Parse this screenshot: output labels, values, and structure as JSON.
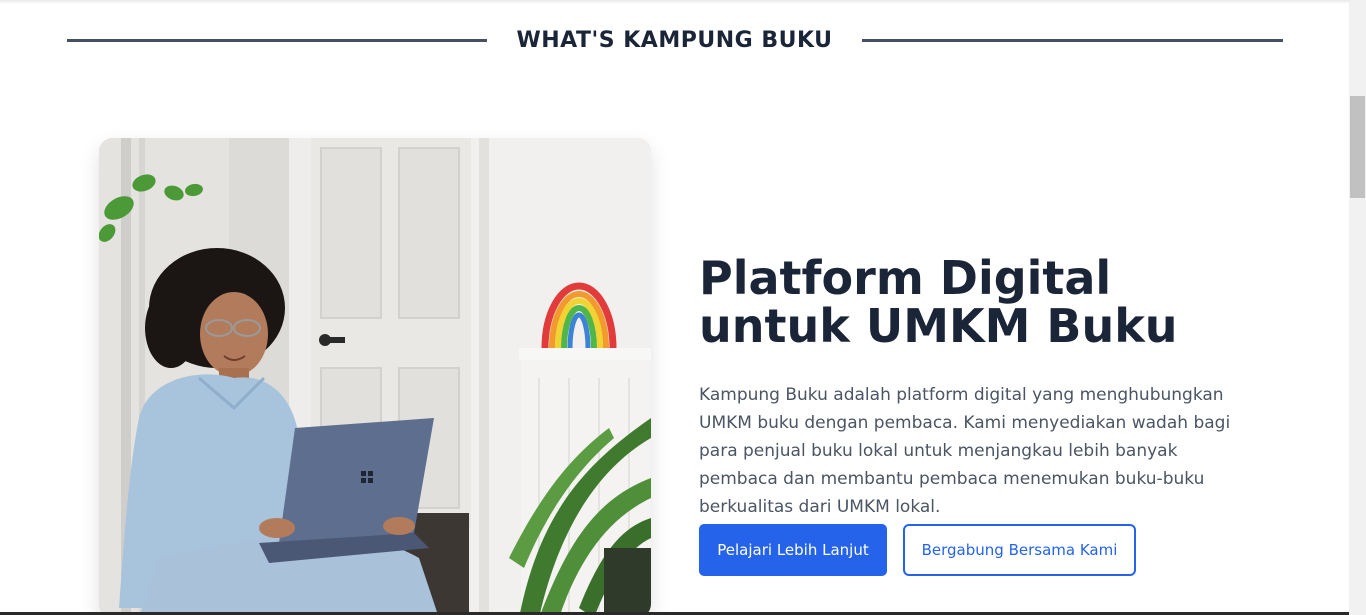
{
  "section": {
    "title": "WHAT'S KAMPUNG BUKU"
  },
  "about": {
    "heading": "Platform Digital untuk UMKM Buku",
    "description": "Kampung Buku adalah platform digital yang menghubungkan UMKM buku dengan pembaca. Kami menyediakan wadah bagi para penjual buku lokal untuk menjangkau lebih banyak pembaca dan membantu pembaca menemukan buku-buku berkualitas dari UMKM lokal.",
    "primary_button": "Pelajari Lebih Lanjut",
    "secondary_button": "Bergabung Bersama Kami"
  },
  "colors": {
    "accent": "#2563eb",
    "heading": "#1b2538",
    "body_text": "#4b5563"
  }
}
